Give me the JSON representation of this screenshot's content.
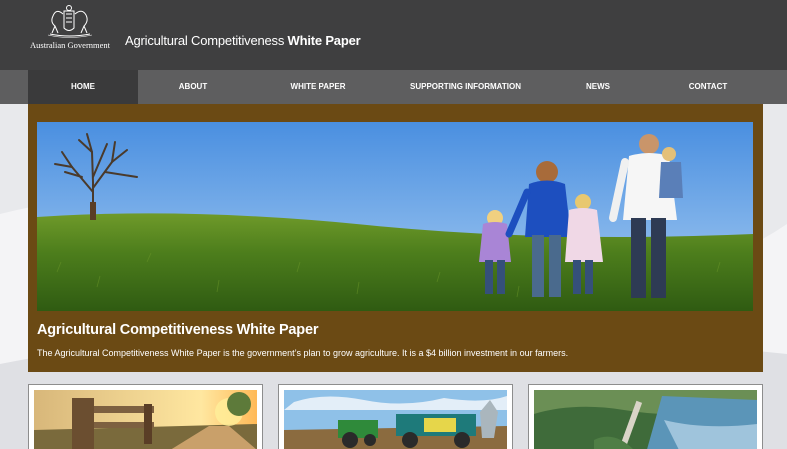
{
  "header": {
    "org_name": "Australian Government",
    "site_title_regular": "Agricultural Competitiveness ",
    "site_title_bold": "White Paper"
  },
  "nav": {
    "items": [
      {
        "label": "HOME",
        "active": true
      },
      {
        "label": "ABOUT",
        "active": false
      },
      {
        "label": "WHITE PAPER",
        "active": false
      },
      {
        "label": "SUPPORTING INFORMATION",
        "active": false
      },
      {
        "label": "NEWS",
        "active": false
      },
      {
        "label": "CONTACT",
        "active": false
      }
    ]
  },
  "hero": {
    "title": "Agricultural Competitiveness White Paper",
    "description": "The Agricultural Competitiveness White Paper is the government’s plan to grow agriculture. It is a $4 billion investment in our farmers."
  },
  "colors": {
    "header_bg": "#3f3f40",
    "nav_bg": "#5e5e5f",
    "nav_active_bg": "#3a3a3b",
    "hero_frame": "#6b4a14",
    "page_bg": "#e8e9ec"
  }
}
